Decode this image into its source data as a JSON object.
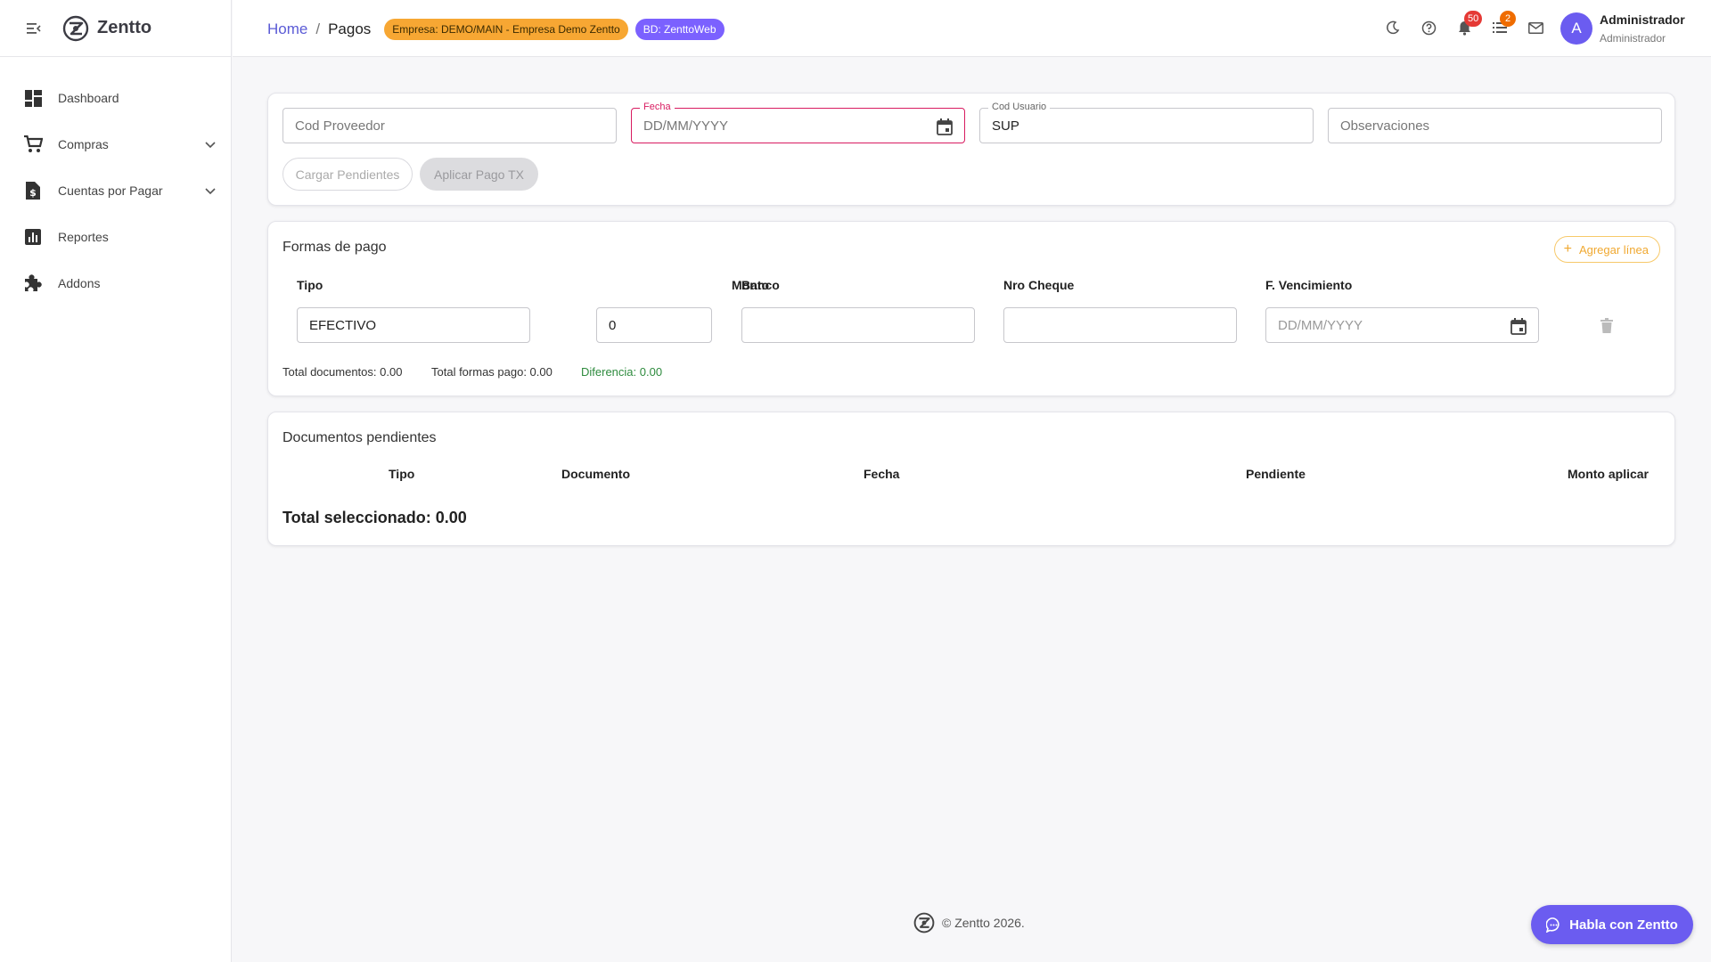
{
  "app": {
    "name": "Zentto"
  },
  "sidebar": {
    "items": [
      {
        "label": "Dashboard"
      },
      {
        "label": "Compras"
      },
      {
        "label": "Cuentas por Pagar"
      },
      {
        "label": "Reportes"
      },
      {
        "label": "Addons"
      }
    ]
  },
  "topbar": {
    "breadcrumb": {
      "home": "Home",
      "separator": "/",
      "current": "Pagos"
    },
    "badges": {
      "empresa": "Empresa: DEMO/MAIN - Empresa Demo Zentto",
      "bd": "BD: ZenttoWeb"
    },
    "notifications_count": "50",
    "tasks_count": "2",
    "user": {
      "initial": "A",
      "name": "Administrador",
      "role": "Administrador"
    }
  },
  "form": {
    "cod_proveedor": {
      "placeholder": "Cod Proveedor",
      "value": ""
    },
    "fecha": {
      "label": "Fecha",
      "placeholder": "DD/MM/YYYY"
    },
    "cod_usuario": {
      "label": "Cod Usuario",
      "value": "SUP"
    },
    "observaciones": {
      "placeholder": "Observaciones",
      "value": ""
    },
    "cargar_label": "Cargar Pendientes",
    "aplicar_label": "Aplicar Pago TX"
  },
  "formas_pago": {
    "title": "Formas de pago",
    "add_label": "Agregar línea",
    "columns": {
      "tipo": "Tipo",
      "monto": "Monto",
      "banco": "Banco",
      "cheque": "Nro Cheque",
      "vencimiento": "F. Vencimiento"
    },
    "row": {
      "tipo": "EFECTIVO",
      "monto": "0",
      "banco": "",
      "cheque": "",
      "vencimiento_placeholder": "DD/MM/YYYY"
    },
    "totals": {
      "documentos": "Total documentos: 0.00",
      "formas": "Total formas pago: 0.00",
      "diferencia": "Diferencia: 0.00"
    }
  },
  "documentos": {
    "title": "Documentos pendientes",
    "columns": {
      "tipo": "Tipo",
      "documento": "Documento",
      "fecha": "Fecha",
      "pendiente": "Pendiente",
      "monto_aplicar": "Monto aplicar"
    },
    "total_seleccionado": "Total seleccionado: 0.00"
  },
  "footer": {
    "text": "© Zentto 2026."
  },
  "chat": {
    "label": "Habla con Zentto"
  },
  "colors": {
    "accent": "#6b5cf0",
    "empresa_badge": "#f7a733",
    "error": "#d81b60",
    "success": "#2e8b3e",
    "warning": "#f0a830"
  }
}
